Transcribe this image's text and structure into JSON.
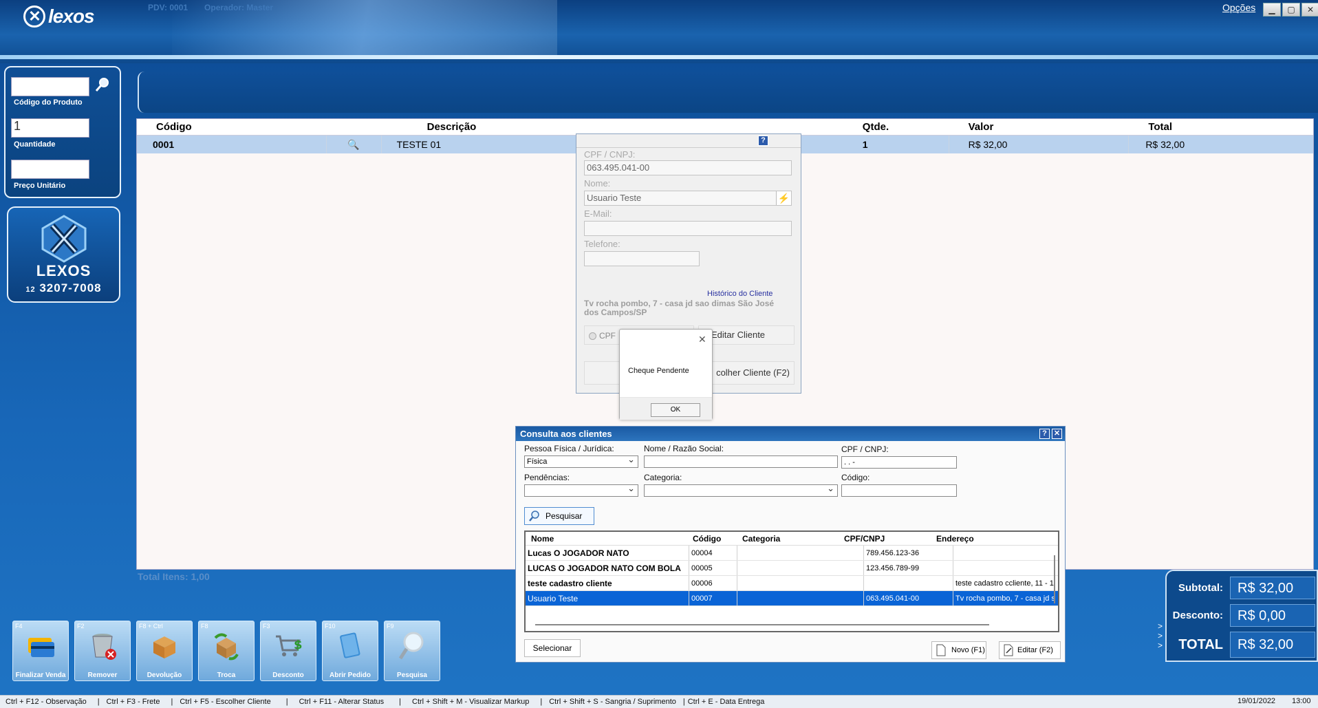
{
  "header": {
    "brand": "lexos",
    "pdv": "PDV: 0001",
    "operador": "Operador: Master",
    "options_label": "Opções"
  },
  "left_panel": {
    "codigo_label": "Código do Produto",
    "codigo_value": "",
    "quantidade_label": "Quantidade",
    "quantidade_value": "1",
    "preco_label": "Preço Unitário",
    "preco_value": ""
  },
  "brand_box": {
    "name": "LEXOS",
    "area": "12",
    "phone": "3207-7008"
  },
  "grid": {
    "columns": [
      "Código",
      "",
      "Descrição",
      "Qtde.",
      "Valor",
      "Total"
    ],
    "rows": [
      {
        "codigo": "0001",
        "descricao": "TESTE 01",
        "qtde": "1",
        "valor": "R$ 32,00",
        "total": "R$ 32,00"
      }
    ],
    "total_itens": "Total Itens: 1,00"
  },
  "totals": {
    "subtotal_label": "Subtotal:",
    "subtotal": "R$ 32,00",
    "desconto_label": "Desconto:",
    "desconto": "R$ 0,00",
    "total_label": "TOTAL",
    "total": "R$ 32,00"
  },
  "fkeys": [
    {
      "key": "F4",
      "label": "Finalizar Venda",
      "icon": "credit-card-icon"
    },
    {
      "key": "F2",
      "label": "Remover",
      "icon": "trash-icon"
    },
    {
      "key": "F8 + Ctrl",
      "label": "Devolução",
      "icon": "box-icon"
    },
    {
      "key": "F8",
      "label": "Troca",
      "icon": "exchange-icon"
    },
    {
      "key": "F3",
      "label": "Desconto",
      "icon": "cart-icon"
    },
    {
      "key": "F10",
      "label": "Abrir Pedido",
      "icon": "folder-icon"
    },
    {
      "key": "F9",
      "label": "Pesquisa",
      "icon": "magnifier-icon"
    }
  ],
  "statusbar": {
    "shortcuts": [
      "Ctrl + F12 - Observação",
      "Ctrl + F3 - Frete",
      "Ctrl + F5 - Escolher Cliente",
      "Ctrl + F11 - Alterar Status",
      "Ctrl + Shift + M - Visualizar Markup",
      "Ctrl + Shift + S - Sangria / Suprimento",
      "Ctrl + E - Data Entrega"
    ],
    "date": "19/01/2022",
    "time": "13:00"
  },
  "client_dialog": {
    "cpf_label": "CPF / CNPJ:",
    "cpf_value": "063.495.041-00",
    "nome_label": "Nome:",
    "nome_value": "Usuario Teste",
    "email_label": "E-Mail:",
    "email_value": "",
    "telefone_label": "Telefone:",
    "telefone_value": "",
    "historico_link": "Histórico do Cliente",
    "address": "Tv rocha pombo, 7 - casa jd sao dimas São José dos Campos/SP",
    "radio_cpf": "CPF",
    "editar_label": "Editar Cliente",
    "escolher_label": "colher Cliente (F2)"
  },
  "message_box": {
    "text": "Cheque Pendente",
    "ok_label": "OK"
  },
  "consulta": {
    "title": "Consulta aos clientes",
    "pessoa_label": "Pessoa Física / Jurídica:",
    "pessoa_value": "Física",
    "nome_label": "Nome / Razão Social:",
    "nome_value": "",
    "cpf_label": "CPF / CNPJ:",
    "cpf_value": " .  .  -",
    "pendencias_label": "Pendências:",
    "pendencias_value": "",
    "categoria_label": "Categoria:",
    "categoria_value": "",
    "codigo_label": "Código:",
    "codigo_value": "",
    "pesquisar_label": "Pesquisar",
    "columns": [
      "Nome",
      "Código",
      "Categoria",
      "CPF/CNPJ",
      "Endereço"
    ],
    "rows": [
      {
        "nome": "Lucas O JOGADOR NATO",
        "codigo": "00004",
        "categoria": "",
        "cpf": "789.456.123-36",
        "endereco": ""
      },
      {
        "nome": "LUCAS O JOGADOR NATO COM BOLA",
        "codigo": "00005",
        "categoria": "",
        "cpf": "123.456.789-99",
        "endereco": ""
      },
      {
        "nome": "teste cadastro cliente",
        "codigo": "00006",
        "categoria": "",
        "cpf": "",
        "endereco": "teste cadastro ccliente, 11 - 1"
      },
      {
        "nome": "Usuario Teste",
        "codigo": "00007",
        "categoria": "",
        "cpf": "063.495.041-00",
        "endereco": "Tv rocha pombo, 7 - casa jd s"
      }
    ],
    "selected_row": 3,
    "selecionar_label": "Selecionar",
    "novo_label": "Novo (F1)",
    "editar_label": "Editar (F2)"
  }
}
